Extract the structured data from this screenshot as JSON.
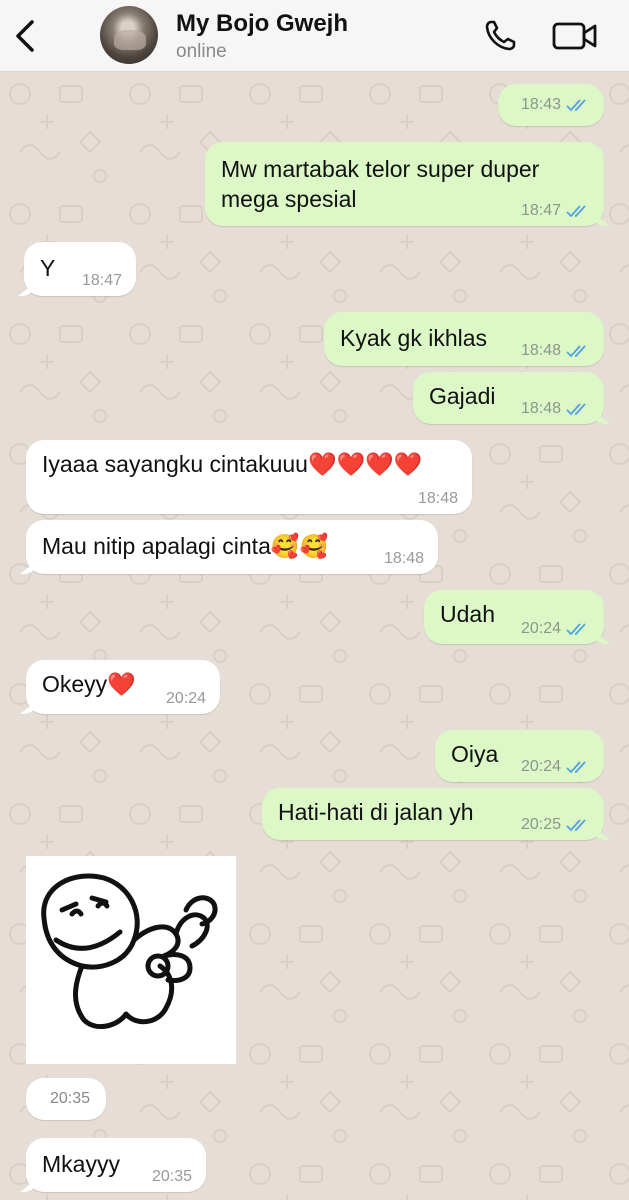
{
  "header": {
    "contact_name": "My Bojo Gwejh",
    "status": "online"
  },
  "icons": {
    "back": "chevron-left-icon",
    "call": "phone-icon",
    "video": "video-camera-icon",
    "read_receipt": "double-check-icon"
  },
  "colors": {
    "outgoing_bubble": "#dcf8c6",
    "incoming_bubble": "#ffffff",
    "read_ticks": "#4fa3e0",
    "chat_background": "#e6ded6"
  },
  "messages": [
    {
      "dir": "out",
      "text": "",
      "time": "18:43"
    },
    {
      "dir": "out",
      "text": "Mw martabak telor super duper mega spesial",
      "time": "18:47"
    },
    {
      "dir": "in",
      "text": "Y",
      "time": "18:47"
    },
    {
      "dir": "out",
      "text": "Kyak gk ikhlas",
      "time": "18:48"
    },
    {
      "dir": "out",
      "text": "Gajadi",
      "time": "18:48"
    },
    {
      "dir": "in",
      "text": "Iyaaa sayangku cintakuuu❤️❤️❤️❤️",
      "time": "18:48"
    },
    {
      "dir": "in",
      "text": "Mau nitip apalagi cinta🥰🥰",
      "time": "18:48"
    },
    {
      "dir": "out",
      "text": "Udah",
      "time": "20:24"
    },
    {
      "dir": "in",
      "text": "Okeyy❤️",
      "time": "20:24"
    },
    {
      "dir": "out",
      "text": "Oiya",
      "time": "20:24"
    },
    {
      "dir": "out",
      "text": "Hati-hati di jalan yh",
      "time": "20:25"
    },
    {
      "dir": "in",
      "text": "",
      "time": "20:35",
      "kind": "sticker"
    },
    {
      "dir": "in",
      "text": "Mkayyy",
      "time": "20:35"
    }
  ]
}
